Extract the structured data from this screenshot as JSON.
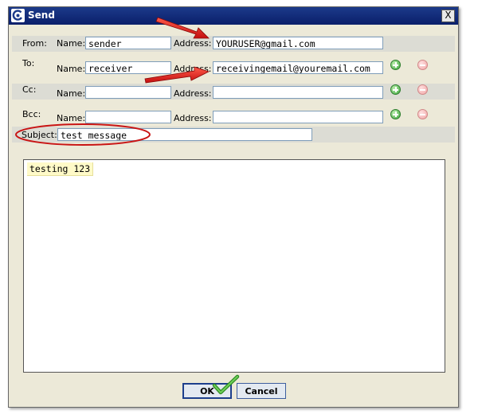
{
  "window": {
    "title": "Send",
    "close_symbol": "X"
  },
  "labels": {
    "from": "From:",
    "to": "To:",
    "cc": "Cc:",
    "bcc": "Bcc:",
    "name": "Name:",
    "address": "Address:",
    "subject": "Subject:"
  },
  "fields": {
    "from_name": "sender",
    "from_address": "YOURUSER@gmail.com",
    "to_name": "receiver",
    "to_address": "receivingemail@youremail.com",
    "cc_name": "",
    "cc_address": "",
    "bcc_name": "",
    "bcc_address": "",
    "subject": "test message"
  },
  "body_text": "testing 123",
  "buttons": {
    "ok": "OK",
    "cancel": "Cancel"
  },
  "icons": {
    "add": "add-recipient-icon",
    "remove": "remove-recipient-icon"
  },
  "colors": {
    "arrow": "#e21b1b",
    "ellipse": "#c91414",
    "checkmark": "#3faa2b",
    "dialog_bg": "#ECE9D8"
  }
}
